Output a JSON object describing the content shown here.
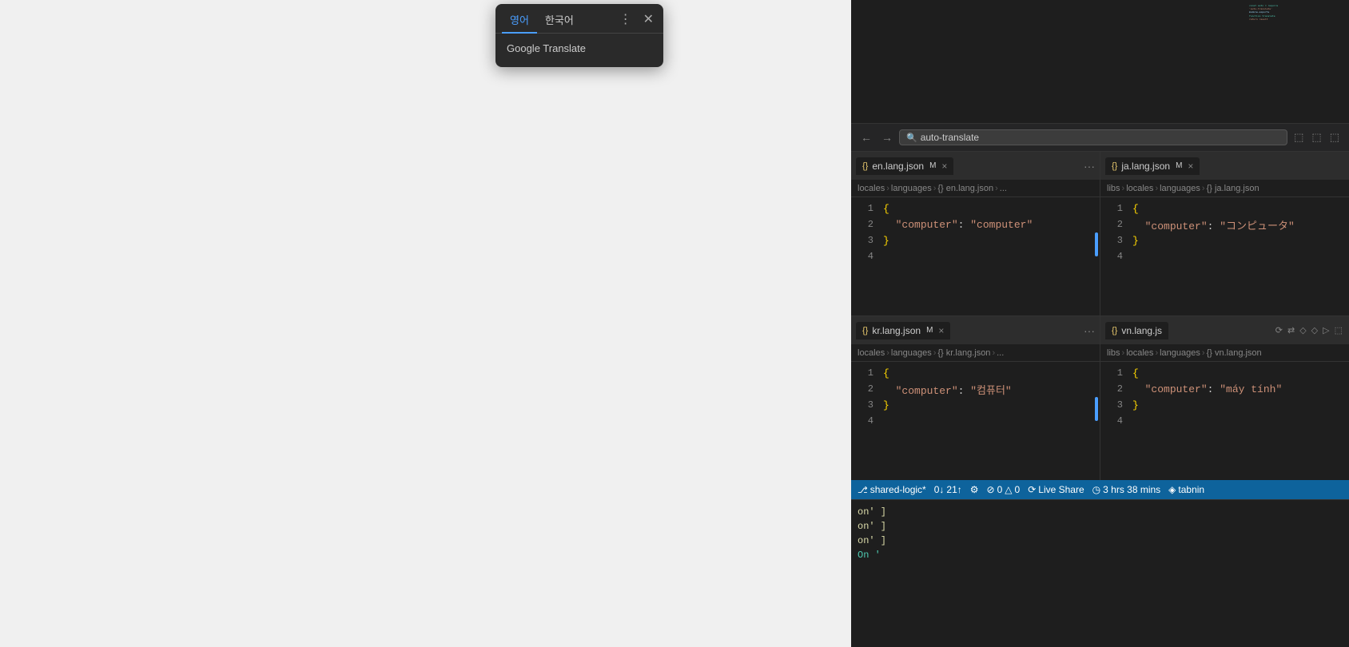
{
  "browser": {
    "background_color": "#f0f0f0"
  },
  "translate_popup": {
    "tab1_label": "영어",
    "tab2_label": "한국어",
    "more_icon": "⋮",
    "close_icon": "✕",
    "body_label": "Google Translate"
  },
  "vscode": {
    "toolbar": {
      "back_icon": "←",
      "forward_icon": "→",
      "search_placeholder": "auto-translate",
      "search_value": "auto-translate",
      "layout_icon1": "⬜",
      "layout_icon2": "⬜",
      "layout_icon3": "⬜"
    },
    "pane_top_left": {
      "tab_label": "en.lang.json",
      "tab_modified": "M",
      "tab_close": "×",
      "more_icon": "···",
      "breadcrumb": "locales > languages > {} en.lang.json > ...",
      "lines": [
        {
          "num": "1",
          "content": "{"
        },
        {
          "num": "2",
          "content": "  \"computer\": \"computer\""
        },
        {
          "num": "3",
          "content": "}"
        },
        {
          "num": "4",
          "content": ""
        }
      ]
    },
    "pane_top_right": {
      "tab_label": "ja.lang.json",
      "tab_modified": "M",
      "tab_close": "×",
      "breadcrumb": "libs > locales > languages > {} ja.lang.json",
      "lines": [
        {
          "num": "1",
          "content": "{"
        },
        {
          "num": "2",
          "content": "  \"computer\": \"コンピュータ\""
        },
        {
          "num": "3",
          "content": "}"
        },
        {
          "num": "4",
          "content": ""
        }
      ]
    },
    "pane_bottom_left": {
      "tab_label": "kr.lang.json",
      "tab_modified": "M",
      "tab_close": "×",
      "more_icon": "···",
      "breadcrumb": "locales > languages > {} kr.lang.json > ...",
      "lines": [
        {
          "num": "1",
          "content": "{"
        },
        {
          "num": "2",
          "content": "  \"computer\": \"컴퓨터\""
        },
        {
          "num": "3",
          "content": "}"
        },
        {
          "num": "4",
          "content": ""
        }
      ]
    },
    "pane_bottom_right": {
      "tab_label": "vn.lang.js",
      "breadcrumb": "libs > locales > languages > {} vn.lang.json",
      "lines": [
        {
          "num": "1",
          "content": "{"
        },
        {
          "num": "2",
          "content": "  \"computer\": \"máy tính\""
        },
        {
          "num": "3",
          "content": "}"
        },
        {
          "num": "4",
          "content": ""
        }
      ]
    },
    "status_bar": {
      "branch": "shared-logic*",
      "sync_icon": "↓",
      "sync_down": "0↓",
      "sync_up": "21↑",
      "format_icon": "⚙",
      "errors_icon": "⊘",
      "errors": "0",
      "warnings_icon": "△",
      "warnings": "0",
      "live_share_icon": "⟳",
      "live_share": "Live Share",
      "time_icon": "◷",
      "time": "3 hrs 38 mins",
      "tabnine_icon": "◈",
      "tabnine": "tabnin"
    },
    "terminal": {
      "lines": [
        "on' ]",
        "on' ]",
        "on' ]",
        "On '"
      ]
    }
  }
}
